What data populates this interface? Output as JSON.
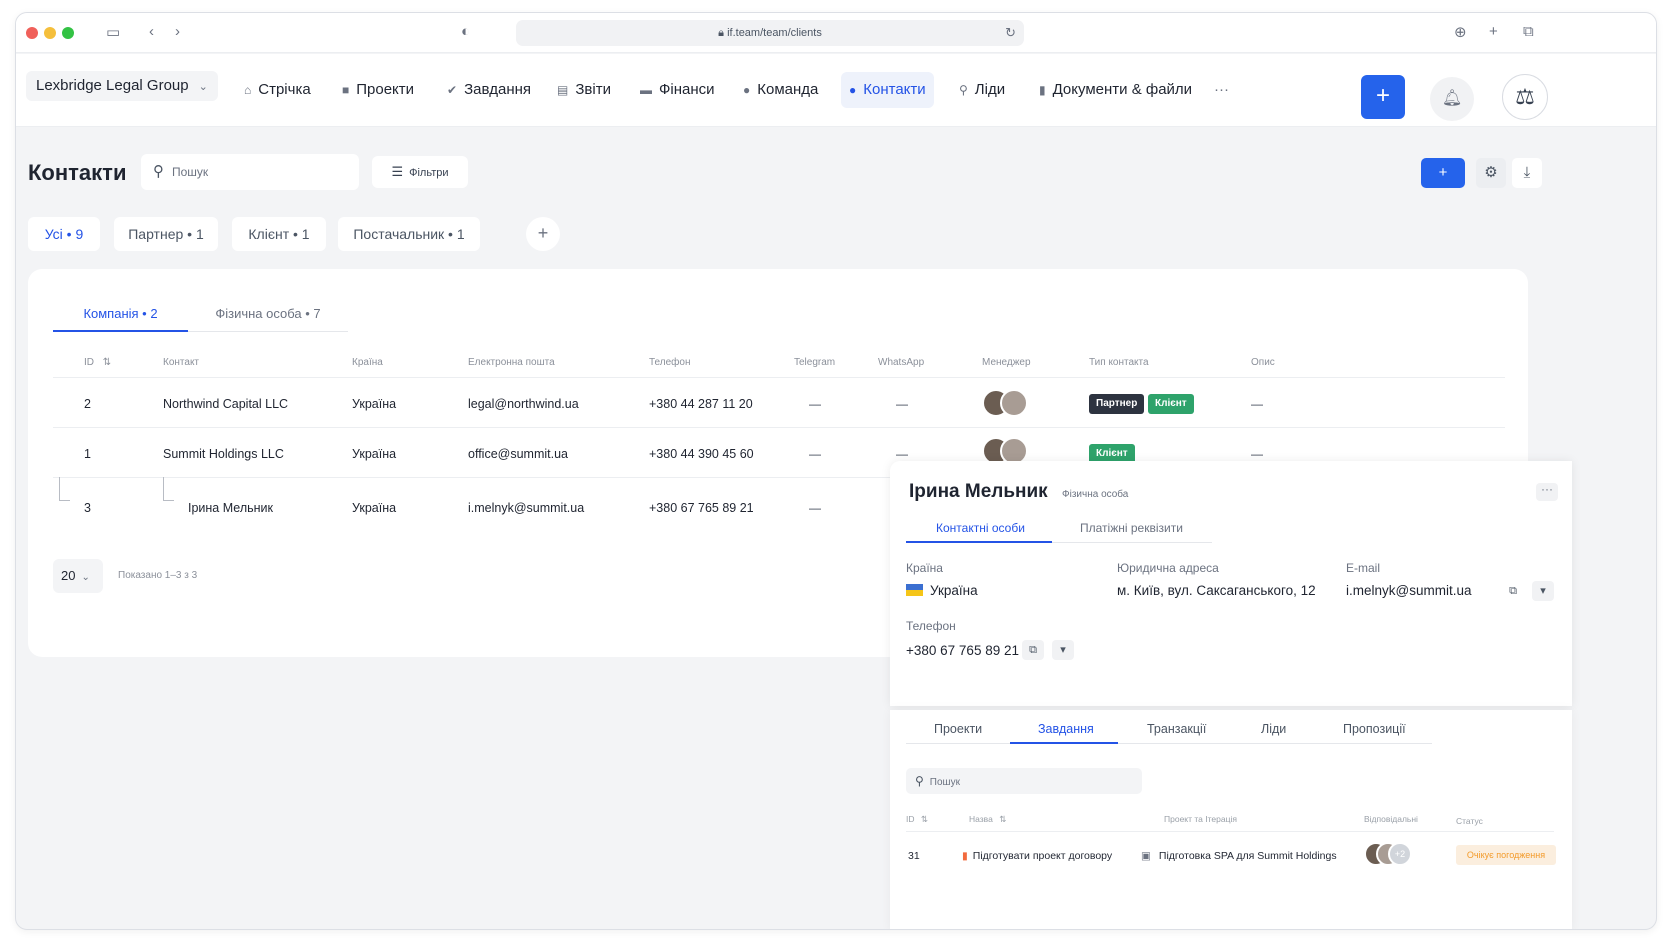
{
  "browser": {
    "url": "if.team/team/clients"
  },
  "header": {
    "org": "Lexbridge Legal Group",
    "nav": [
      {
        "label": "Стрічка",
        "icon": "home-icon"
      },
      {
        "label": "Проекти",
        "icon": "folder-icon"
      },
      {
        "label": "Завдання",
        "icon": "check-icon"
      },
      {
        "label": "Звіти",
        "icon": "report-icon"
      },
      {
        "label": "Фінанси",
        "icon": "wallet-icon"
      },
      {
        "label": "Команда",
        "icon": "team-icon"
      },
      {
        "label": "Контакти",
        "icon": "contacts-icon"
      },
      {
        "label": "Ліди",
        "icon": "leads-icon"
      },
      {
        "label": "Документи & файли",
        "icon": "documents-icon"
      }
    ],
    "more": "···",
    "plus": "+"
  },
  "page": {
    "title": "Контакти",
    "search_placeholder": "Пошук",
    "filters_label": "Фільтри",
    "add": "+"
  },
  "pills": [
    "Усі • 9",
    "Партнер • 1",
    "Клієнт • 1",
    "Постачальник • 1"
  ],
  "subtabs": [
    "Компанія • 2",
    "Фізична особа • 7"
  ],
  "table": {
    "columns": [
      "ID",
      "Контакт",
      "Країна",
      "Електронна пошта",
      "Телефон",
      "Telegram",
      "WhatsApp",
      "Менеджер",
      "Тип контакта",
      "Опис"
    ],
    "rows": [
      {
        "id": "2",
        "contact": "Northwind Capital LLC",
        "country": "Україна",
        "email": "legal@northwind.ua",
        "phone": "+380 44 287 11 20",
        "telegram": "—",
        "whatsapp": "—",
        "tags": [
          "Партнер",
          "Клієнт"
        ],
        "desc": "—"
      },
      {
        "id": "1",
        "contact": "Summit Holdings LLC",
        "country": "Україна",
        "email": "office@summit.ua",
        "phone": "+380 44 390 45 60",
        "telegram": "—",
        "whatsapp": "—",
        "tags": [
          "Клієнт"
        ],
        "desc": "—"
      },
      {
        "id": "3",
        "contact": "Ірина Мельник",
        "country": "Україна",
        "email": "i.melnyk@summit.ua",
        "phone": "+380 67 765 89 21",
        "telegram": "—"
      }
    ],
    "page_size": "20",
    "showing": "Показано 1–3 з 3"
  },
  "panel": {
    "name": "Ірина Мельник",
    "type": "Фізична особа",
    "tabs": [
      "Контактні особи",
      "Платіжні реквізити"
    ],
    "country_label": "Країна",
    "country": "Україна",
    "address_label": "Юридична адреса",
    "address": "м. Київ, вул. Саксаганського, 12",
    "email_label": "E-mail",
    "email": "i.melnyk@summit.ua",
    "phone_label": "Телефон",
    "phone": "+380 67 765 89 21",
    "bottom_tabs": [
      "Проекти",
      "Завдання",
      "Транзакції",
      "Ліди",
      "Пропозиції"
    ],
    "search_placeholder": "Пошук",
    "task_columns": [
      "ID",
      "Назва",
      "Проект та Ітерація",
      "Відповідальні",
      "Статус"
    ],
    "task": {
      "id": "31",
      "name": "Підготувати проект договору",
      "project": "Підготовка SPA для Summit Holdings",
      "extra": "+2",
      "status": "Очікує погодження"
    }
  },
  "colors": {
    "accent": "#2563eb",
    "tag_dark": "#2d3340",
    "tag_green": "#2ea36b",
    "status_orange": "#f39b2b"
  }
}
